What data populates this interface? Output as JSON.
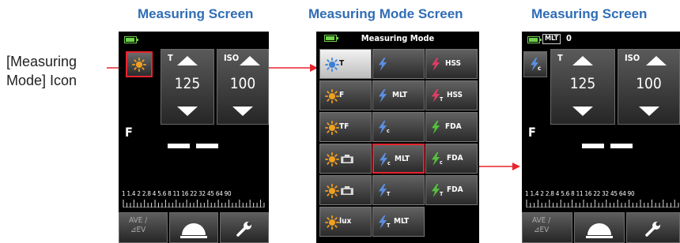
{
  "headings": {
    "left": "Measuring Screen",
    "middle": "Measuring Mode Screen",
    "right": "Measuring Screen"
  },
  "side_label": {
    "line1": "[Measuring",
    "line2": "Mode] Icon"
  },
  "measure_screen_left": {
    "t_label": "T",
    "t_value": "125",
    "iso_label": "ISO",
    "iso_value": "100",
    "f_label": "F",
    "scale_text": "1 1.4 2 2.8 4 5.6 8 11 16 22 32 45 64 90",
    "ave_line1": "AVE /",
    "ave_line2": "⊿EV"
  },
  "mode_menu": {
    "title": "Measuring Mode",
    "cells": [
      {
        "text": "T"
      },
      {
        "text": ""
      },
      {
        "text": "HSS"
      },
      {
        "text": "F"
      },
      {
        "text": "MLT"
      },
      {
        "text": "HSS"
      },
      {
        "text": "TF"
      },
      {
        "text": ""
      },
      {
        "text": "FDA"
      },
      {
        "text": ""
      },
      {
        "text": "MLT"
      },
      {
        "text": "FDA"
      },
      {
        "text": ""
      },
      {
        "text": ""
      },
      {
        "text": "FDA"
      },
      {
        "text": "lux"
      },
      {
        "text": "MLT"
      }
    ]
  },
  "measure_screen_right": {
    "badge": "MLT",
    "counter": "0",
    "t_label": "T",
    "t_value": "125",
    "iso_label": "ISO",
    "iso_value": "100",
    "f_label": "F",
    "scale_text": "1 1.4 2 2.8 4 5.6 8 11 16 22 32 45 64 90",
    "ave_line1": "AVE /",
    "ave_line2": "⊿EV"
  },
  "colors": {
    "heading_blue": "#2f6db5",
    "highlight_red": "#e8242f",
    "sun_orange": "#f0a020",
    "flash_pink": "#e03c64",
    "cord_blue": "#5b8fe0",
    "wireless_green": "#54c23a"
  },
  "icons": [
    "sun-icon",
    "flash-icon",
    "cordless-flash-icon",
    "cord-flash-icon",
    "dome-icon",
    "wrench-icon",
    "battery-icon"
  ]
}
